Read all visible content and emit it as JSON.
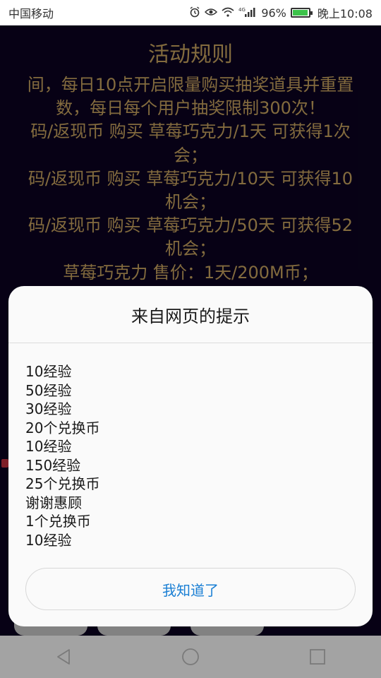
{
  "status_bar": {
    "carrier": "中国移动",
    "network": "4G",
    "battery_percent": "96%",
    "battery_level": 0.96,
    "time": "晚上10:08",
    "icons": [
      "alarm-icon",
      "eye-icon",
      "wifi-icon",
      "signal-icon",
      "battery-icon"
    ]
  },
  "page": {
    "rules_title": "活动规则",
    "rule_lines": [
      "间，每日10点开启限量购买抽奖道具并重置",
      "数，每日每个用户抽奖限制300次！",
      "码/返现币 购买 草莓巧克力/1天 可获得1次",
      "会；",
      "码/返现币 购买 草莓巧克力/10天 可获得10",
      "机会；",
      "码/返现币 购买 草莓巧克力/50天 可获得52",
      "机会；",
      "草莓巧克力 售价：1天/200M币；"
    ]
  },
  "dialog": {
    "title": "来自网页的提示",
    "messages": [
      "10经验",
      "50经验",
      "30经验",
      "20个兑换币",
      "10经验",
      "150经验",
      "25个兑换币",
      "谢谢惠顾",
      "1个兑换币",
      "10经验"
    ],
    "button_label": "我知道了"
  },
  "nav_bar": {
    "icons": [
      "back-icon",
      "home-icon",
      "recents-icon"
    ]
  },
  "colors": {
    "page_background": "#0b0321",
    "rule_text": "#c9a560",
    "dialog_button_text": "#1a7fd4",
    "battery_fill": "#3cc24a"
  }
}
